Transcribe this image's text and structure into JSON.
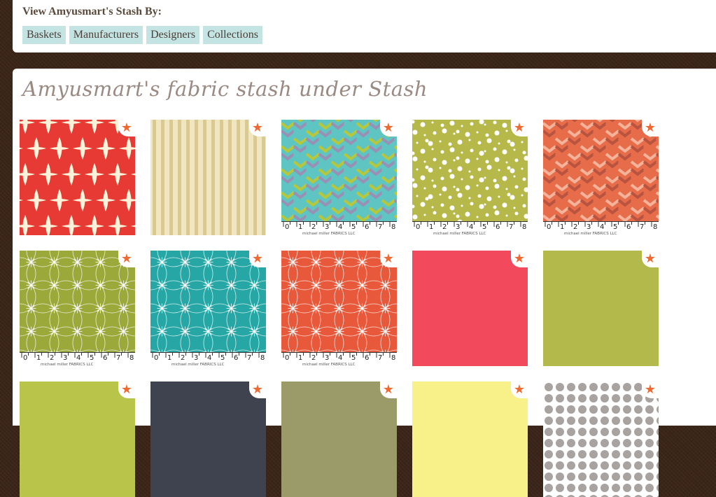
{
  "header": {
    "heading": "View Amyusmart's Stash By:",
    "tabs": [
      "Baskets",
      "Manufacturers",
      "Designers",
      "Collections"
    ]
  },
  "main": {
    "title": "Amyusmart's fabric stash under Stash",
    "ruler_brand": "michael miller FABRICS LLC",
    "ruler_numbers": [
      "0",
      "1",
      "2",
      "3",
      "4",
      "5",
      "6",
      "7",
      "8"
    ],
    "swatches": [
      {
        "name": "red-ikat-diamond",
        "pattern": "ikat",
        "colors": [
          "#e83a34",
          "#fbf3d9"
        ],
        "ruler": false
      },
      {
        "name": "cream-stripe",
        "pattern": "stripe",
        "colors": [
          "#f1e6c2",
          "#d9c992"
        ],
        "ruler": false
      },
      {
        "name": "teal-chevron",
        "pattern": "chevron",
        "colors": [
          "#5ec5c3",
          "#b7c73c",
          "#9a8fb5",
          "#ffffff"
        ],
        "ruler": true
      },
      {
        "name": "green-floral",
        "pattern": "floral",
        "colors": [
          "#b6b94a",
          "#ffffff"
        ],
        "ruler": true
      },
      {
        "name": "coral-chevron",
        "pattern": "chevron",
        "colors": [
          "#e76c4a",
          "#f4b39a",
          "#b8543f",
          "#ffffff"
        ],
        "ruler": true
      },
      {
        "name": "green-starburst",
        "pattern": "starburst",
        "colors": [
          "#9ba93a",
          "#ffffff"
        ],
        "ruler": true
      },
      {
        "name": "teal-starburst",
        "pattern": "starburst",
        "colors": [
          "#26a7a5",
          "#ffffff"
        ],
        "ruler": true
      },
      {
        "name": "orange-starburst",
        "pattern": "starburst",
        "colors": [
          "#e8593b",
          "#ffffff"
        ],
        "ruler": true
      },
      {
        "name": "pink-solid",
        "pattern": "solid",
        "colors": [
          "#f24a5c"
        ],
        "ruler": false
      },
      {
        "name": "olive-green-solid",
        "pattern": "solid",
        "colors": [
          "#b3b94a"
        ],
        "ruler": false
      },
      {
        "name": "lime-solid",
        "pattern": "solid",
        "colors": [
          "#b8c44a"
        ],
        "ruler": false
      },
      {
        "name": "charcoal-solid",
        "pattern": "solid",
        "colors": [
          "#3f4350"
        ],
        "ruler": false
      },
      {
        "name": "khaki-solid",
        "pattern": "solid",
        "colors": [
          "#9a9b68"
        ],
        "ruler": false
      },
      {
        "name": "yellow-solid",
        "pattern": "solid",
        "colors": [
          "#f8f088"
        ],
        "ruler": false
      },
      {
        "name": "gray-dots",
        "pattern": "dots",
        "colors": [
          "#ffffff",
          "#a8a3a0"
        ],
        "ruler": false
      }
    ]
  }
}
